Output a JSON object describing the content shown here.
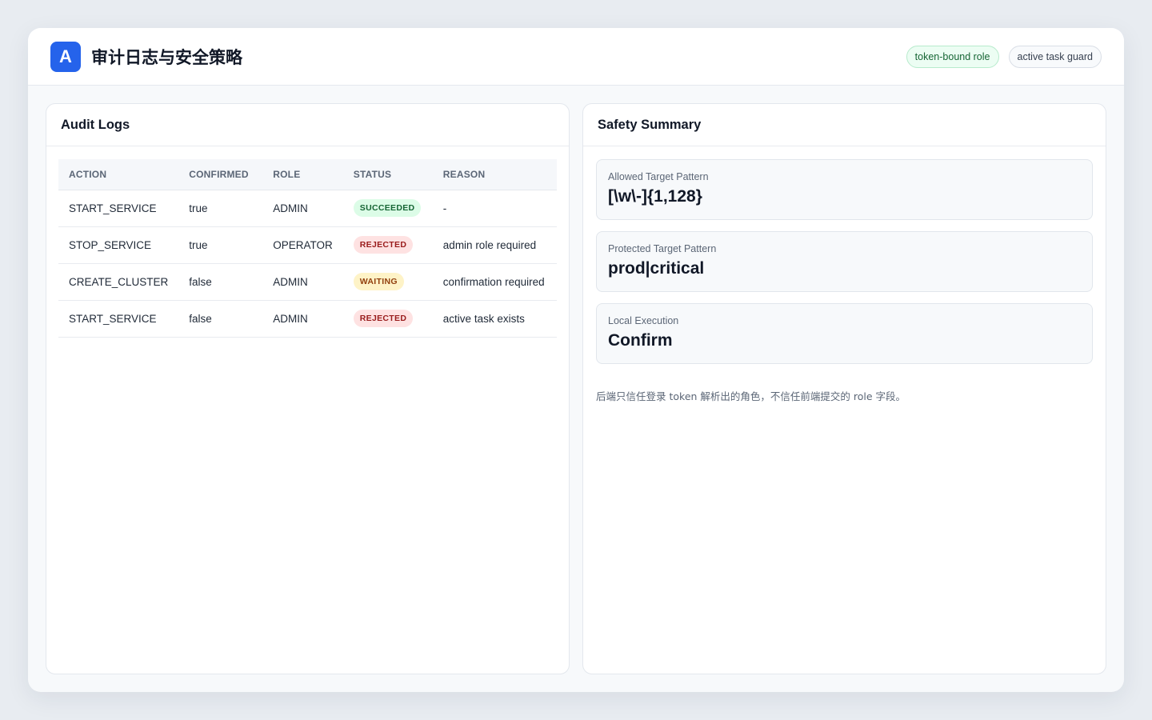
{
  "header": {
    "logo_letter": "A",
    "title": "审计日志与安全策略",
    "tags": [
      "token-bound role",
      "active task guard"
    ]
  },
  "audit_logs": {
    "title": "Audit Logs",
    "columns": [
      "ACTION",
      "CONFIRMED",
      "ROLE",
      "STATUS",
      "REASON"
    ],
    "rows": [
      {
        "action": "START_SERVICE",
        "confirmed": "true",
        "role": "ADMIN",
        "status": "SUCCEEDED",
        "reason": "-"
      },
      {
        "action": "STOP_SERVICE",
        "confirmed": "true",
        "role": "OPERATOR",
        "status": "REJECTED",
        "reason": "admin role required"
      },
      {
        "action": "CREATE_CLUSTER",
        "confirmed": "false",
        "role": "ADMIN",
        "status": "WAITING",
        "reason": "confirmation required"
      },
      {
        "action": "START_SERVICE",
        "confirmed": "false",
        "role": "ADMIN",
        "status": "REJECTED",
        "reason": "active task exists"
      }
    ]
  },
  "safety_summary": {
    "title": "Safety Summary",
    "cards": [
      {
        "label": "Allowed Target Pattern",
        "value": "[\\w\\-]{1,128}"
      },
      {
        "label": "Protected Target Pattern",
        "value": "prod|critical"
      },
      {
        "label": "Local Execution",
        "value": "Confirm"
      }
    ],
    "note": "后端只信任登录 token 解析出的角色，不信任前端提交的 role 字段。"
  },
  "colors": {
    "accent": "#2563eb",
    "succeeded": "#166534",
    "rejected": "#991b1b",
    "waiting": "#92400e"
  }
}
